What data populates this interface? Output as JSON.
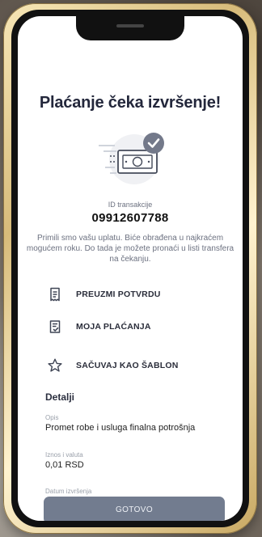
{
  "header": {
    "title": "Plaćanje čeka izvršenje!"
  },
  "transaction": {
    "id_label": "ID transakcije",
    "id_value": "09912607788"
  },
  "message": {
    "text": "Primili smo vašu uplatu. Biće obrađena u najkraćem mogućem roku. Do tada je možete pronaći u listi transfera na čekanju."
  },
  "actions": [
    {
      "label": "PREUZMI POTVRDU",
      "icon": "receipt-icon"
    },
    {
      "label": "MOJA PLAĆANJA",
      "icon": "document-check-icon"
    },
    {
      "label": "SAČUVAJ KAO ŠABLON",
      "icon": "star-icon"
    }
  ],
  "details": {
    "title": "Detalji",
    "items": [
      {
        "label": "Opis",
        "value": "Promet robe i usluga finalna potrošnja"
      },
      {
        "label": "Iznos i valuta",
        "value": "0,01 RSD"
      },
      {
        "label": "Datum izvršenja",
        "value": ""
      }
    ]
  },
  "footer": {
    "button_label": "GOTOVO"
  },
  "colors": {
    "title": "#23273b",
    "muted": "#6c7180",
    "accent": "#727c8f",
    "success_badge": "#73798a"
  }
}
